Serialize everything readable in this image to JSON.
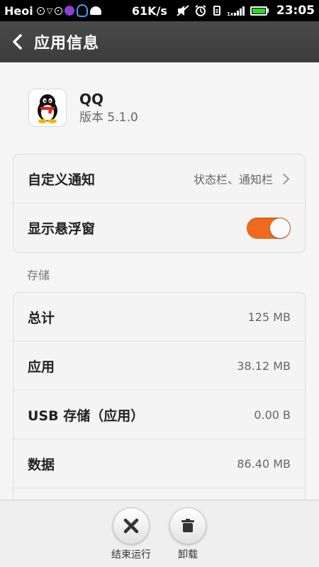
{
  "status_bar": {
    "carrier": "Heoi",
    "net_speed": "61K/s",
    "time": "23:05"
  },
  "header": {
    "title": "应用信息"
  },
  "app": {
    "name": "QQ",
    "version": "版本 5.1.0"
  },
  "settings": {
    "notification_label": "自定义通知",
    "notification_value": "状态栏、通知栏",
    "float_window_label": "显示悬浮窗",
    "float_window_enabled": true
  },
  "storage": {
    "section_label": "存储",
    "rows": [
      {
        "label": "总计",
        "value": "125 MB"
      },
      {
        "label": "应用",
        "value": "38.12 MB"
      },
      {
        "label": "USB 存储（应用）",
        "value": "0.00 B"
      },
      {
        "label": "数据",
        "value": "86.40 MB"
      }
    ]
  },
  "actions": {
    "force_stop_label": "结束运行",
    "uninstall_label": "卸载"
  },
  "colors": {
    "toggle_on": "#f06a1e",
    "battery": "#2fd62f"
  }
}
